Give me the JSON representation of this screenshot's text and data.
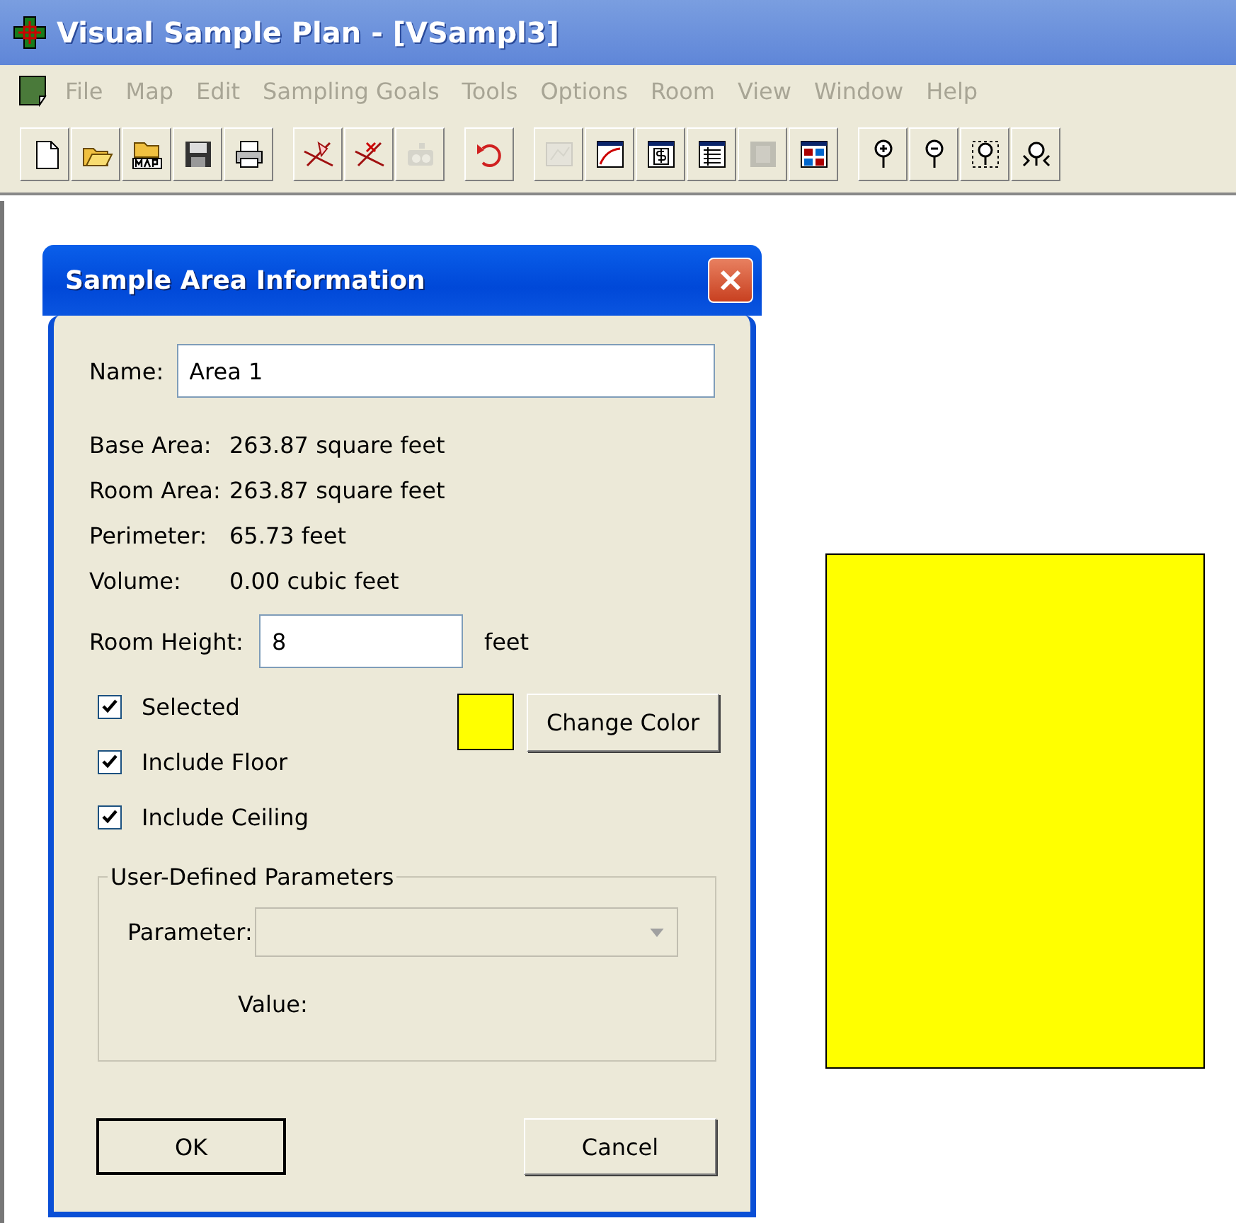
{
  "window": {
    "title": "Visual Sample Plan - [VSampl3]"
  },
  "menu": [
    {
      "label": "File",
      "disabled": true
    },
    {
      "label": "Map",
      "disabled": true
    },
    {
      "label": "Edit",
      "disabled": true
    },
    {
      "label": "Sampling Goals",
      "disabled": true
    },
    {
      "label": "Tools",
      "disabled": true
    },
    {
      "label": "Options",
      "disabled": true
    },
    {
      "label": "Room",
      "disabled": true
    },
    {
      "label": "View",
      "disabled": true
    },
    {
      "label": "Window",
      "disabled": true
    },
    {
      "label": "Help",
      "disabled": true
    }
  ],
  "toolbar": [
    [
      {
        "kind": "new",
        "disabled": false
      },
      {
        "kind": "open",
        "disabled": false
      },
      {
        "kind": "openmap",
        "disabled": false
      },
      {
        "kind": "save",
        "disabled": false
      },
      {
        "kind": "print",
        "disabled": false
      }
    ],
    [
      {
        "kind": "lineadd",
        "disabled": false
      },
      {
        "kind": "lineremove",
        "disabled": false
      },
      {
        "kind": "camera",
        "disabled": true
      }
    ],
    [
      {
        "kind": "undo",
        "disabled": false
      }
    ],
    [
      {
        "kind": "map",
        "disabled": true
      },
      {
        "kind": "chart",
        "disabled": false
      },
      {
        "kind": "dollar",
        "disabled": false
      },
      {
        "kind": "table",
        "disabled": false
      },
      {
        "kind": "film",
        "disabled": true
      },
      {
        "kind": "grid",
        "disabled": false
      }
    ],
    [
      {
        "kind": "zoomin",
        "disabled": false
      },
      {
        "kind": "zoomout",
        "disabled": false
      },
      {
        "kind": "zoombox",
        "disabled": false
      },
      {
        "kind": "zoomextents",
        "disabled": false
      }
    ]
  ],
  "canvas": {
    "shapes": [
      {
        "kind": "rectangle",
        "color": "#ffff00"
      }
    ]
  },
  "dialog": {
    "title": "Sample Area Information",
    "name": {
      "label": "Name:",
      "value": "Area 1"
    },
    "info": [
      {
        "label": "Base Area:",
        "value": "263.87 square feet"
      },
      {
        "label": "Room Area:",
        "value": "263.87 square feet"
      },
      {
        "label": "Perimeter:",
        "value": "65.73 feet"
      },
      {
        "label": "Volume:",
        "value": "0.00 cubic feet"
      }
    ],
    "room_height": {
      "label": "Room Height:",
      "value": "8",
      "unit": "feet"
    },
    "checkboxes": [
      {
        "label": "Selected",
        "checked": true
      },
      {
        "label": "Include Floor",
        "checked": true
      },
      {
        "label": "Include Ceiling",
        "checked": true
      }
    ],
    "color": "#ffff00",
    "change_color_button": "Change Color",
    "parameters": {
      "legend": "User-Defined Parameters",
      "parameter_label": "Parameter:",
      "disabled": true,
      "value_label": "Value:"
    },
    "buttons": [
      "OK",
      "Cancel"
    ]
  }
}
